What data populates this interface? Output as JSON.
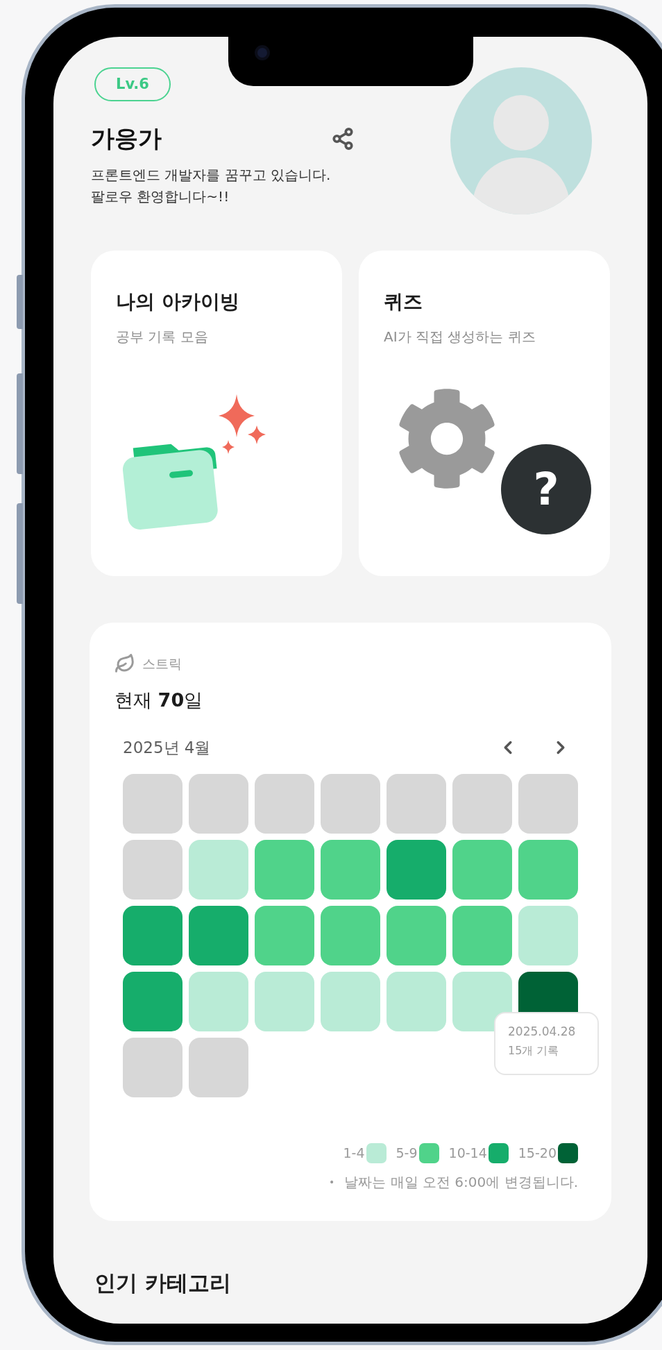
{
  "profile": {
    "level_badge": "Lv.6",
    "name": "가응가",
    "bio": [
      "프론트엔드 개발자를 꿈꾸고 있습니다.",
      "팔로우 환영합니다~!!"
    ]
  },
  "cards": [
    {
      "kind": "archive",
      "title": "나의 아카이빙",
      "subtitle": "공부 기록 모음"
    },
    {
      "kind": "quiz",
      "title": "퀴즈",
      "subtitle": "AI가 직접 생성하는 퀴즈",
      "icon_text": "?"
    }
  ],
  "streak": {
    "label": "스트릭",
    "current": "현재 **70**일",
    "month": "2025년 4월",
    "weeks": [
      [
        {
          "color": "#d7d7d7"
        },
        {
          "color": "#d7d7d7"
        },
        {
          "color": "#d7d7d7"
        },
        {
          "color": "#d7d7d7"
        },
        {
          "color": "#d7d7d7"
        },
        {
          "color": "#d7d7d7"
        },
        {
          "color": "#d7d7d7"
        }
      ],
      [
        {
          "color": "#d7d7d7"
        },
        {
          "color": "#b9ebd6"
        },
        {
          "color": "#50d38a"
        },
        {
          "color": "#50d38a"
        },
        {
          "color": "#16ad6b"
        },
        {
          "color": "#50d38a"
        },
        {
          "color": "#50d38a"
        }
      ],
      [
        {
          "color": "#16ad6b"
        },
        {
          "color": "#16ad6b"
        },
        {
          "color": "#50d38a"
        },
        {
          "color": "#50d38a"
        },
        {
          "color": "#50d38a"
        },
        {
          "color": "#50d38a"
        },
        {
          "color": "#b9ebd6"
        }
      ],
      [
        {
          "color": "#16ad6b"
        },
        {
          "color": "#b9ebd6"
        },
        {
          "color": "#b9ebd6"
        },
        {
          "color": "#b9ebd6"
        },
        {
          "color": "#b9ebd6"
        },
        {
          "color": "#b9ebd6"
        },
        {
          "color": "#006236",
          "tooltip": {
            "date": "2025.04.28",
            "count": "15개 기록"
          }
        }
      ],
      [
        {
          "color": "#d7d7d7"
        },
        {
          "color": "#d7d7d7"
        }
      ]
    ],
    "legend": [
      {
        "label": "1-4",
        "color": "#b9ebd6"
      },
      {
        "label": "5-9",
        "color": "#50d38a"
      },
      {
        "label": "10-14",
        "color": "#16ad6b"
      },
      {
        "label": "15-20",
        "color": "#006236"
      }
    ],
    "bullet": "•",
    "note": "날짜는 매일 오전 6:00에 변경됩니다."
  },
  "section_title": "인기 카테고리"
}
